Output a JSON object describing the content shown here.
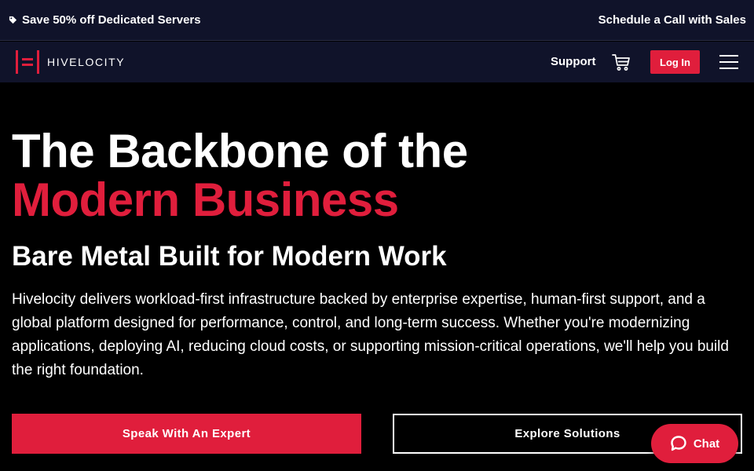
{
  "promo": {
    "left_text": "Save 50% off Dedicated Servers",
    "right_text": "Schedule a Call with Sales"
  },
  "nav": {
    "logo_text": "HIVELOCITY",
    "support_label": "Support",
    "login_label": "Log In"
  },
  "hero": {
    "title_line1": "The Backbone of the",
    "title_line2": "Modern Business",
    "subtitle": "Bare Metal Built for Modern Work",
    "body": "Hivelocity delivers workload-first infrastructure backed by enterprise expertise, human-first support, and a global platform designed for performance, control, and long-term success. Whether you're modernizing applications, deploying AI, reducing cloud costs, or supporting mission-critical operations, we'll help you build the right foundation.",
    "primary_cta": "Speak With An Expert",
    "secondary_cta": "Explore Solutions"
  },
  "chat": {
    "label": "Chat"
  },
  "colors": {
    "brand_red": "#e01e3c",
    "nav_bg": "#10132a",
    "page_bg": "#000000"
  },
  "icons": {
    "promo": "tag-icon",
    "cart": "cart-icon",
    "menu": "hamburger-menu-icon",
    "chat": "chat-bubble-icon"
  }
}
